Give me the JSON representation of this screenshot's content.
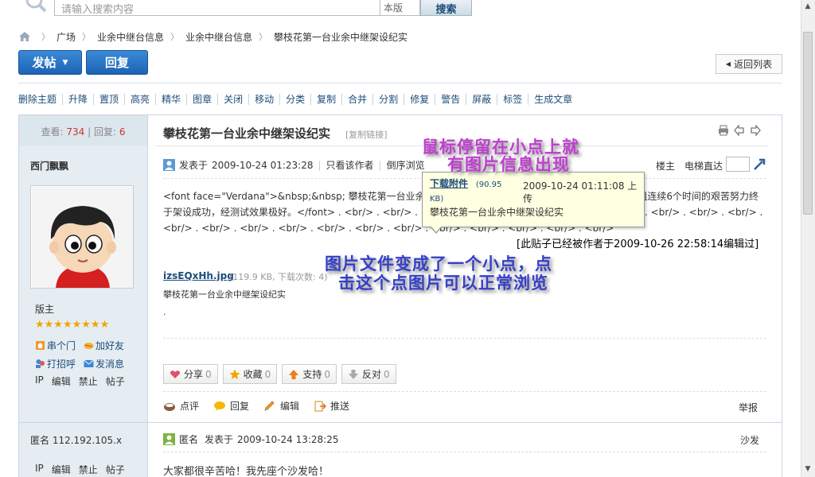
{
  "search": {
    "placeholder": "请输入搜索内容",
    "version": "本版",
    "button": "搜索"
  },
  "breadcrumb": [
    "广场",
    "业余中继台信息",
    "业余中继台信息",
    "攀枝花第一台业余中继架设纪实"
  ],
  "toolbar": {
    "post_label": "发帖",
    "reply_label": "回复",
    "back_label": "返回列表"
  },
  "admin_actions": [
    "删除主题",
    "升降",
    "置顶",
    "高亮",
    "精华",
    "图章",
    "关闭",
    "移动",
    "分类",
    "复制",
    "合并",
    "分割",
    "修复",
    "警告",
    "屏蔽",
    "标签",
    "生成文章"
  ],
  "thread": {
    "views_label": "查看:",
    "views": "734",
    "replies_label": "回复:",
    "replies": "6",
    "title": "攀枝花第一台业余中继架设纪实",
    "copy_link": "[复制链接]"
  },
  "post1": {
    "author": "西门飘飘",
    "role": "版主",
    "stars": "★★★★★★★★",
    "actions": {
      "home": "串个门",
      "add_friend": "加好友",
      "greet": "打招呼",
      "message": "发消息"
    },
    "admin": [
      "IP",
      "编辑",
      "禁止",
      "帖子"
    ],
    "posted_label": "发表于",
    "posted_time": "2009-10-24 01:23:28",
    "author_only": "只看该作者",
    "reverse": "倒序浏览",
    "floor": "楼主",
    "jump": "电梯直达",
    "body": "<font face=\"Verdana\">&nbsp;&nbsp; 攀枝花第一台业余中继架设纪实,攀枝花业余无线电协会中继台管理小组连续6个时间的艰苦努力终于架设成功，经测试效果极好。</font> . <br/> . <br/> . <br/> . <br/> . <br/> . <br/> . <br/> . <br/> . <br/> . <br/> . <br/> . <br/> . <br/> . <br/> . <br/> . <br/> . <br/> . <br/> . <br/> . <br/> . <br/> . <br/> . <br/>",
    "edited_note": "[此贴子已经被作者于2009-10-26 22:58:14编辑过]",
    "attachment": {
      "name": "izsEQxHh.jpg",
      "meta": "(119.9 KB, 下载次数: 4)",
      "desc": "攀枝花第一台业余中继架设纪实",
      "dot": "."
    },
    "votes": [
      {
        "label": "分享",
        "count": "0"
      },
      {
        "label": "收藏",
        "count": "0"
      },
      {
        "label": "支持",
        "count": "0"
      },
      {
        "label": "反对",
        "count": "0"
      }
    ],
    "post_actions": [
      "点评",
      "回复",
      "编辑",
      "推送"
    ],
    "report": "举报"
  },
  "tooltip": {
    "download": "下载附件",
    "size": "(90.95",
    "kb": "KB)",
    "time": "2009-10-24 01:11:08 上传",
    "desc": "攀枝花第一台业余中继架设纪实"
  },
  "post2": {
    "author": "匿名 112.192.105.x",
    "name": "匿名",
    "posted_label": "发表于",
    "posted_time": "2009-10-24 13:28:25",
    "floor": "沙发",
    "body": "大家都很辛苦哈！我先座个沙发哈！",
    "admin": [
      "IP",
      "编辑",
      "禁止",
      "帖子"
    ]
  },
  "annotations": {
    "line1": "鼠标停留在小点上就",
    "line2": "有图片信息出现",
    "line3": "图片文件变成了一个小点，点",
    "line4": "击这个点图片可以正常浏览"
  }
}
